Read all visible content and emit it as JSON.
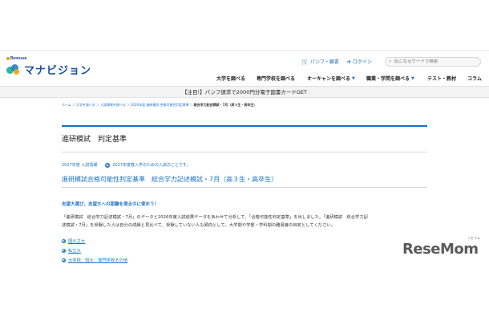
{
  "brand": {
    "company": "Benesse",
    "site_name": "マナビジョン",
    "colors": {
      "primary": "#1a73c4",
      "logo_blue": "#1a4fa0",
      "logo_orange": "#f2a100",
      "logo_green": "#2bb5a0"
    }
  },
  "header": {
    "pamphlet_label": "パンフ・願書",
    "pamphlet_icon": "cart-icon",
    "login_label": "ログイン",
    "login_icon": "login-icon",
    "search_placeholder": "気になるワードで検索",
    "search_icon": "search-icon"
  },
  "nav": {
    "items": [
      {
        "label": "大学を調べる",
        "has_dropdown": false
      },
      {
        "label": "専門学校を調べる",
        "has_dropdown": false
      },
      {
        "label": "オーキャンを調べる",
        "has_dropdown": true
      },
      {
        "label": "職業・学問を調べる",
        "has_dropdown": true
      },
      {
        "label": "テスト・教材",
        "has_dropdown": false
      },
      {
        "label": "コラム",
        "has_dropdown": false
      }
    ]
  },
  "banner": {
    "text": "【注目!】パンフ請求で2000円分電子図書カードGET"
  },
  "breadcrumb": {
    "items": [
      "ホーム",
      "大学を調べる",
      "入試情報を調べる",
      "2026年度 進研模試 合格可能性判定基準"
    ],
    "current": "総合学力記述模試・7月（高３生・高卒生）"
  },
  "page": {
    "title": "進研模試　判定基準",
    "year_label": "2027年度 入試情報",
    "year_note": "2027年度春入学のための入試のことです。",
    "subtitle": "進研模試合格可能性判定基準　総合学力記述模試・7月（高３生・高卒生）",
    "lead": "志望大選び、志望大への距離を測るのに使おう！",
    "body_line1": "「進研模試　総合学力記述模試・7月」のデータと2026年度入試結果データをあわせて分析して、「合格可能性判定基準」を出しました。「進研模試　総合学力記",
    "body_line2": "述模試・7月」を受験した人は自分の成績と見比べて、受験していない人も傾向として、大学間や学部・学科間の難易度の目安としてください。",
    "links": [
      "国公立大",
      "私立大",
      "大学校、短大、専門学校その他"
    ]
  },
  "watermark": {
    "text": "ReseMom",
    "kana": "リセマム"
  }
}
